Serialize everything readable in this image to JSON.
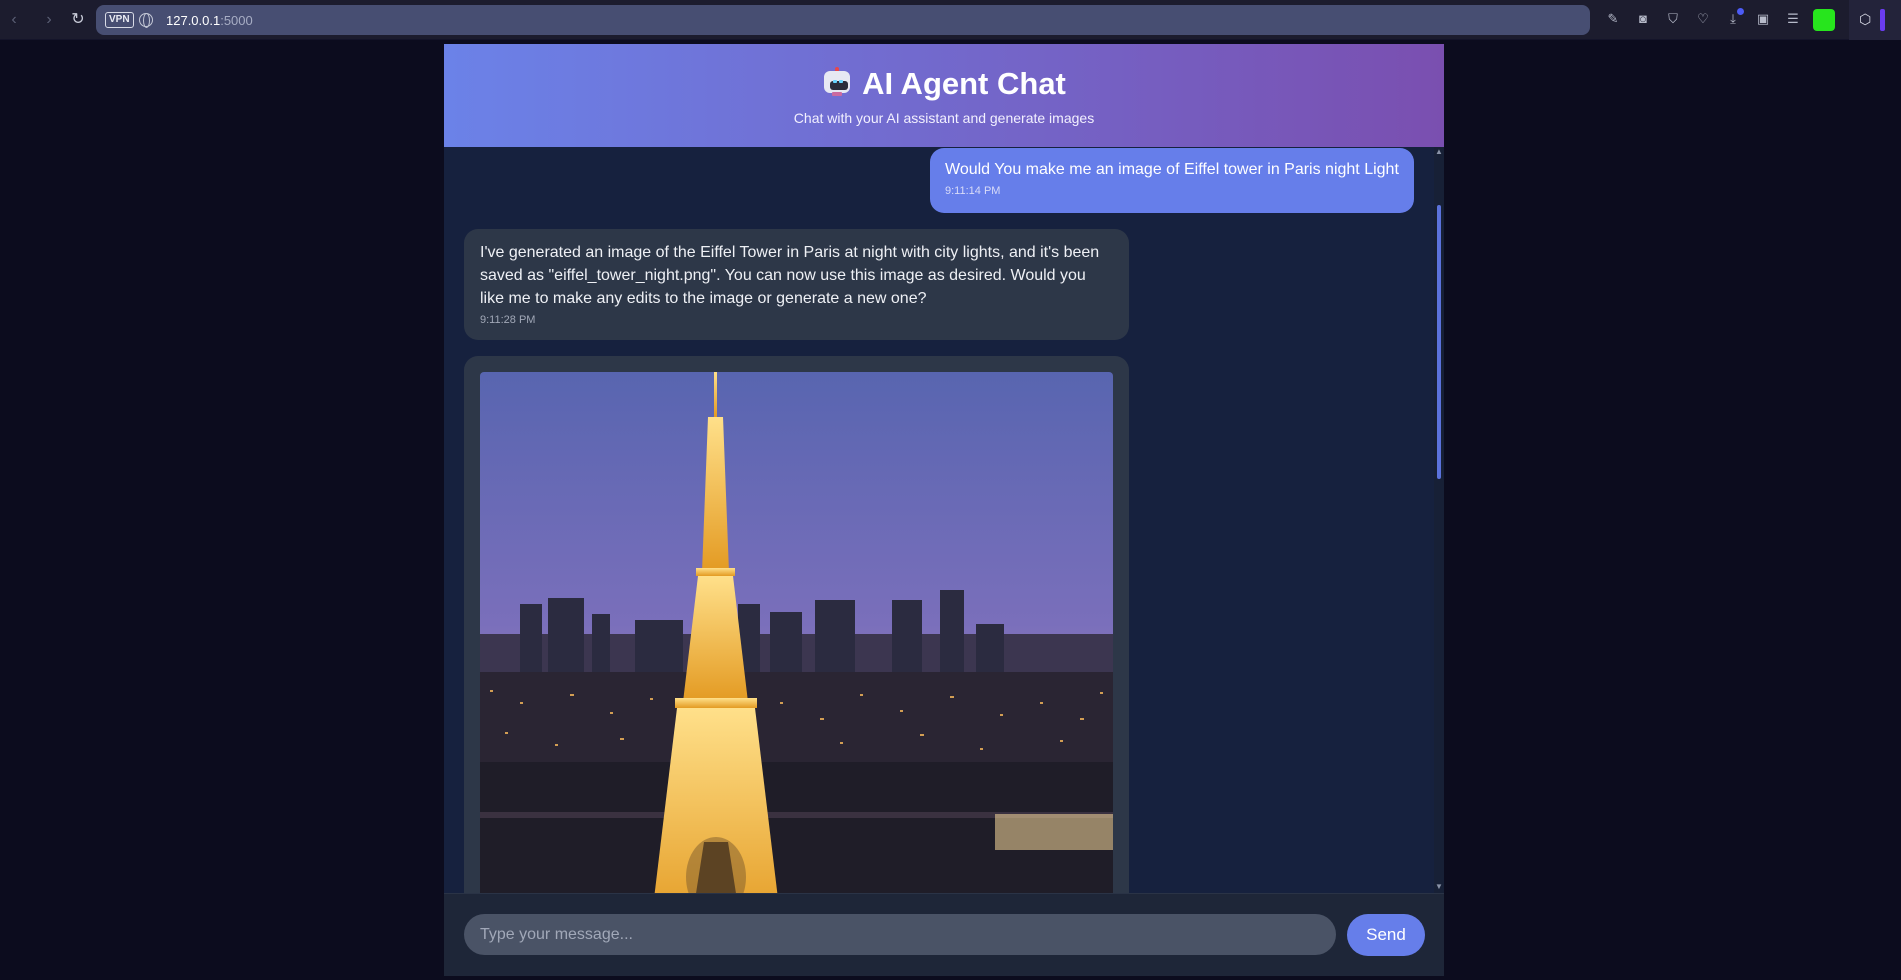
{
  "browser": {
    "vpn_label": "VPN",
    "url_host": "127.0.0.1",
    "url_port": ":5000",
    "accent_color": "#27e51d"
  },
  "header": {
    "title": "AI Agent Chat",
    "subtitle": "Chat with your AI assistant and generate images",
    "gradient_start": "#6b82e8",
    "gradient_end": "#7a4fb0"
  },
  "messages": [
    {
      "role": "user",
      "text": "Would You make me an image of Eiffel tower in Paris night Light",
      "time": "9:11:14 PM"
    },
    {
      "role": "assistant",
      "text": "I've generated an image of the Eiffel Tower in Paris at night with city lights, and it's been saved as \"eiffel_tower_night.png\". You can now use this image as desired. Would you like me to make any edits to the image or generate a new one?",
      "time": "9:11:28 PM"
    }
  ],
  "generated_image": {
    "subject": "eiffel-tower-night-image"
  },
  "composer": {
    "placeholder": "Type your message...",
    "send_label": "Send",
    "send_color": "#667eea"
  }
}
